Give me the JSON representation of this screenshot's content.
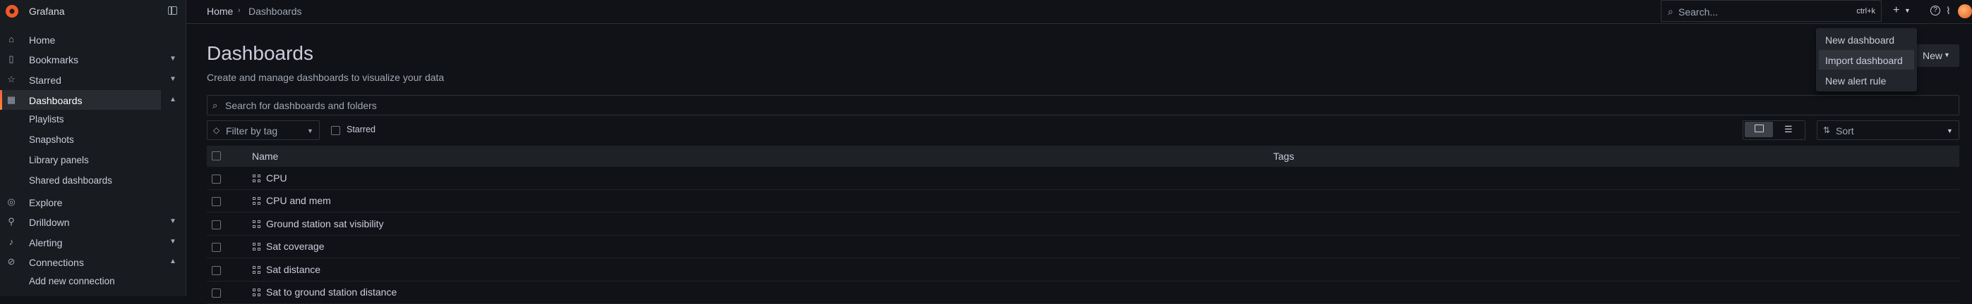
{
  "app": {
    "name": "Grafana",
    "accent": "#f05a28"
  },
  "sidebar": {
    "items": [
      {
        "label": "Home",
        "icon": "home-icon"
      },
      {
        "label": "Bookmarks",
        "icon": "bookmark-icon"
      },
      {
        "label": "Starred",
        "icon": "star-icon"
      },
      {
        "label": "Dashboards",
        "icon": "apps-icon",
        "active": true
      },
      {
        "label": "Explore",
        "icon": "compass-icon"
      },
      {
        "label": "Drilldown",
        "icon": "drilldown-icon"
      },
      {
        "label": "Alerting",
        "icon": "bell-icon"
      },
      {
        "label": "Connections",
        "icon": "plug-icon"
      }
    ],
    "dashboards_children": [
      "Playlists",
      "Snapshots",
      "Library panels",
      "Shared dashboards"
    ],
    "connections_children": [
      "Add new connection"
    ]
  },
  "topbar": {
    "breadcrumb": [
      "Home",
      "Dashboards"
    ],
    "search_placeholder": "Search...",
    "search_shortcut": "ctrl+k"
  },
  "page": {
    "title": "Dashboards",
    "subtitle": "Create and manage dashboards to visualize your data",
    "new_button": "New"
  },
  "filters": {
    "search_placeholder": "Search for dashboards and folders",
    "tag_placeholder": "Filter by tag",
    "starred_label": "Starred",
    "sort_placeholder": "Sort"
  },
  "table": {
    "columns": [
      "Name",
      "Tags"
    ],
    "rows": [
      {
        "name": "CPU"
      },
      {
        "name": "CPU and mem"
      },
      {
        "name": "Ground station sat visibility"
      },
      {
        "name": "Sat coverage"
      },
      {
        "name": "Sat distance"
      },
      {
        "name": "Sat to ground station distance"
      }
    ]
  },
  "new_menu": {
    "items": [
      "New dashboard",
      "Import dashboard",
      "New alert rule"
    ],
    "hovered_index": 1
  }
}
